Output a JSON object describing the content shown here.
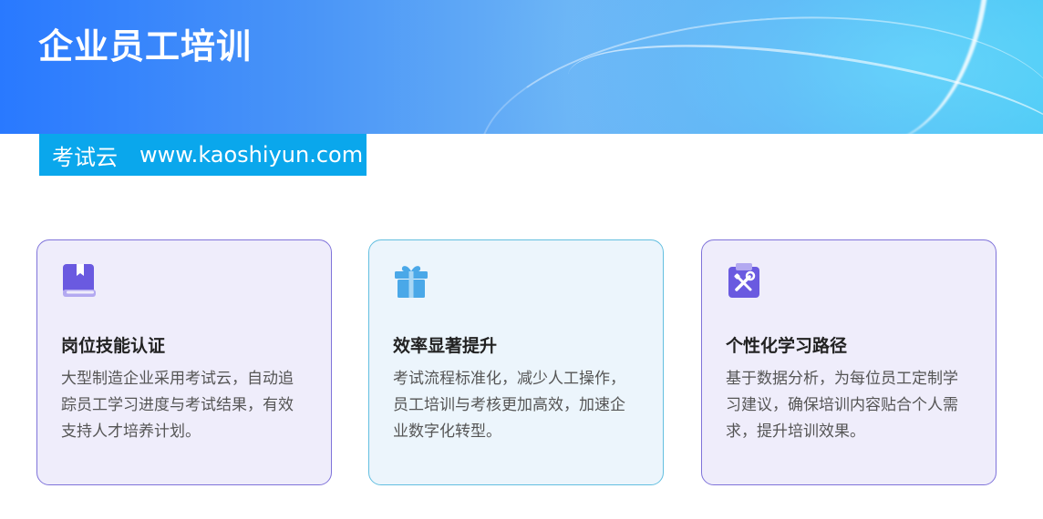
{
  "header": {
    "title": "企业员工培训"
  },
  "brand": {
    "name": "考试云",
    "url": "www.kaoshiyun.com"
  },
  "cards": [
    {
      "icon": "book-icon",
      "title": "岗位技能认证",
      "text": "大型制造企业采用考试云，自动追踪员工学习进度与考试结果，有效支持人才培养计划。"
    },
    {
      "icon": "gift-icon",
      "title": "效率显著提升",
      "text": "考试流程标准化，减少人工操作，员工培训与考核更加高效，加速企业数字化转型。"
    },
    {
      "icon": "clipboard-tools-icon",
      "title": "个性化学习路径",
      "text": "基于数据分析，为每位员工定制学习建议，确保培训内容贴合个人需求，提升培训效果。"
    }
  ],
  "colors": {
    "brand_strip": "#0aa7ec",
    "card_purple_border": "#7f73da",
    "card_blue_border": "#63bfe0",
    "icon_purple": "#6a5ae0",
    "icon_blue": "#4aa8e8"
  }
}
